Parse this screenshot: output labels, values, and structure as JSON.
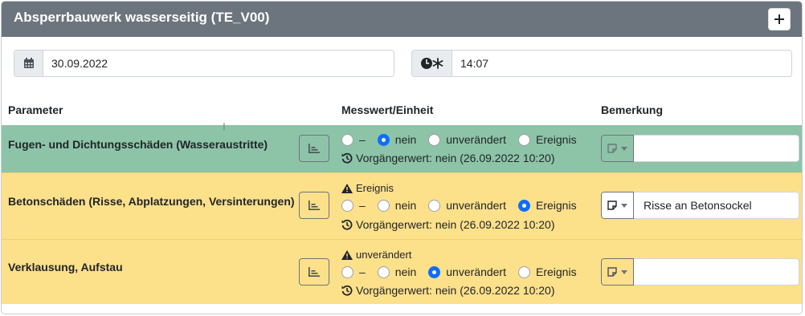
{
  "header": {
    "title": "Absperrbauwerk wasserseitig (TE_V00)",
    "add_icon": "plus-icon"
  },
  "date": {
    "icon": "calendar-icon",
    "value": "30.09.2022"
  },
  "time": {
    "icon": "clock-icon",
    "value": "14:07"
  },
  "columns": {
    "param": "Parameter",
    "measure": "Messwert/Einheit",
    "remark": "Bemerkung"
  },
  "rows": [
    {
      "param": "Fugen- und Dichtungsschäden (Wasseraustritte)",
      "status_color": "#8dc4a8",
      "warning": "",
      "options": [
        "–",
        "nein",
        "unverändert",
        "Ereignis"
      ],
      "selected": "nein",
      "previous": "Vorgängerwert: nein (26.09.2022 10:20)",
      "remark": ""
    },
    {
      "param": "Betonschäden (Risse, Abplatzungen, Versinterungen)",
      "status_color": "#fde08a",
      "warning": "Ereignis",
      "options": [
        "–",
        "nein",
        "unverändert",
        "Ereignis"
      ],
      "selected": "Ereignis",
      "previous": "Vorgängerwert: nein (26.09.2022 10:20)",
      "remark": "Risse an Betonsockel"
    },
    {
      "param": "Verklausung, Aufstau",
      "status_color": "#fde08a",
      "warning": "unverändert",
      "options": [
        "–",
        "nein",
        "unverändert",
        "Ereignis"
      ],
      "selected": "unverändert",
      "previous": "Vorgängerwert: nein (26.09.2022 10:20)",
      "remark": ""
    }
  ]
}
